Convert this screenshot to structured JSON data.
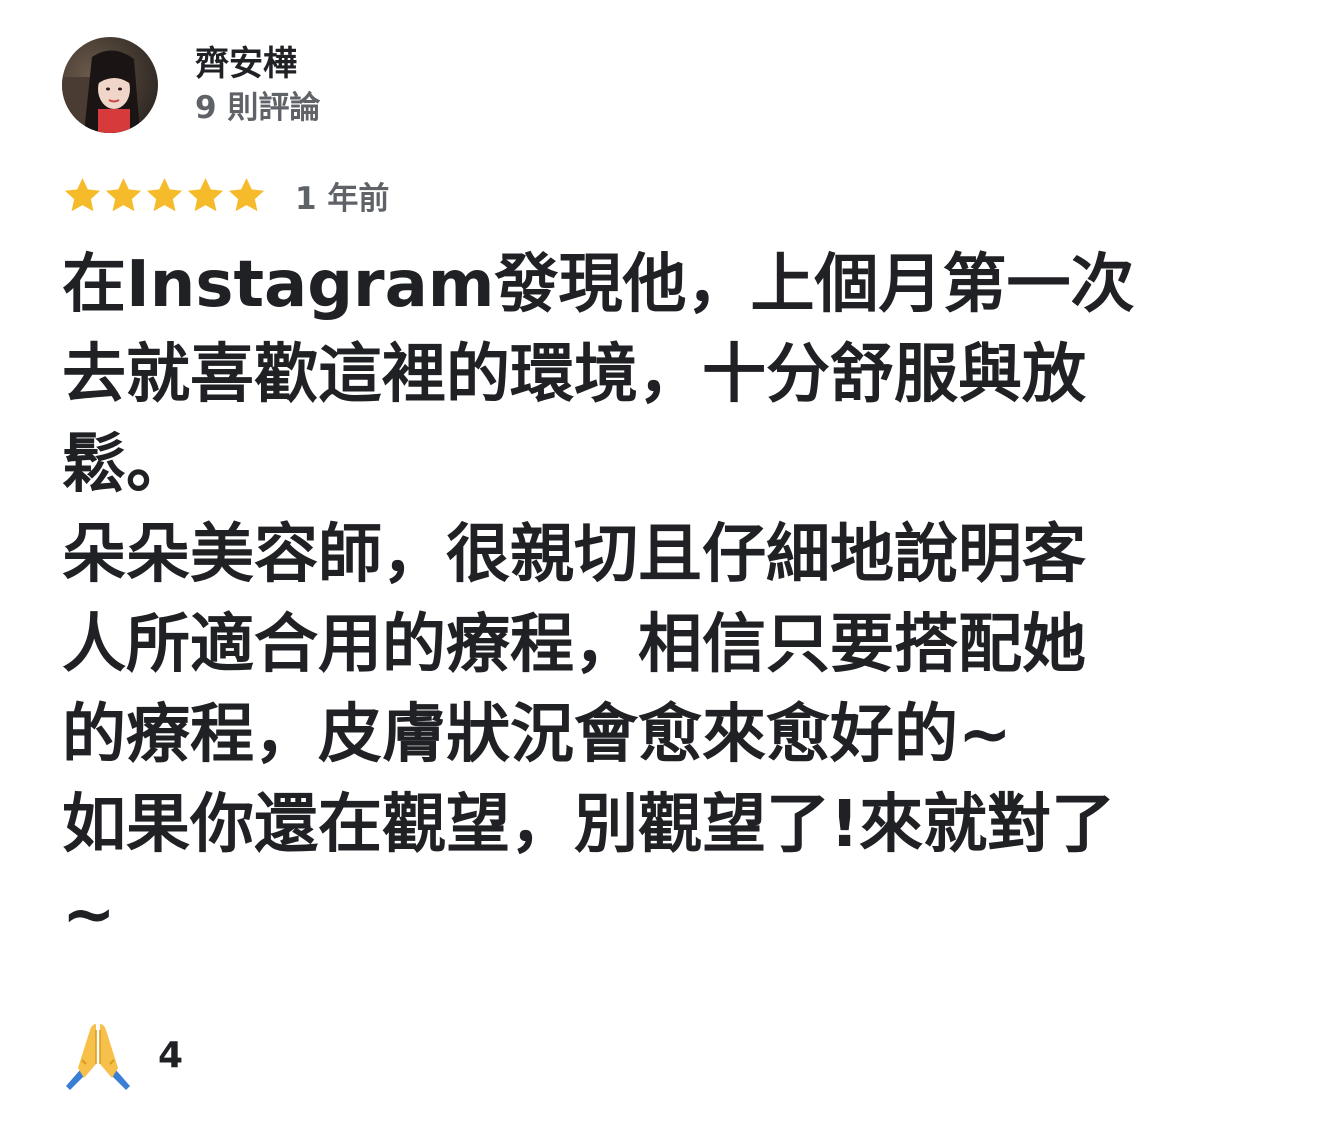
{
  "review": {
    "author": {
      "name": "齊安樺",
      "review_count": "9 則評論"
    },
    "rating": 5,
    "rating_max": 5,
    "star_color": "#f6bb2b",
    "time_ago": "1 年前",
    "text_lines": [
      "在Instagram發現他，上個月第一次",
      "去就喜歡這裡的環境，十分舒服與放",
      "鬆。",
      "朵朵美容師，很親切且仔細地說明客",
      "人所適合用的療程，相信只要搭配她",
      "的療程，皮膚狀況會愈來愈好的~",
      "如果你還在觀望，別觀望了!來就對了",
      "~"
    ],
    "reaction": {
      "icon": "folded-hands-icon",
      "count": "4"
    }
  }
}
